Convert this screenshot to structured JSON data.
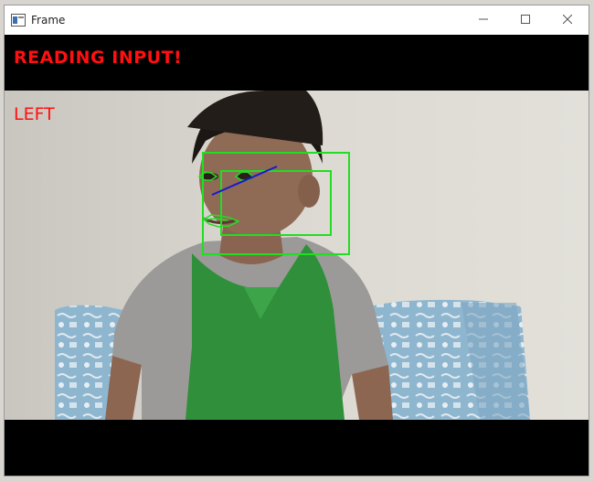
{
  "window": {
    "title": "Frame",
    "minimize_symbol": "–",
    "maximize_symbol": "☐",
    "close_symbol": "✕"
  },
  "overlay": {
    "status": "READING INPUT!",
    "direction": "LEFT",
    "text_color": "#ff1010",
    "box_color": "#22dd22",
    "gaze_line_color": "#1a1acc"
  },
  "icons": {
    "app": "frame-app-icon",
    "minimize": "minimize-icon",
    "maximize": "maximize-icon",
    "close": "close-icon"
  }
}
